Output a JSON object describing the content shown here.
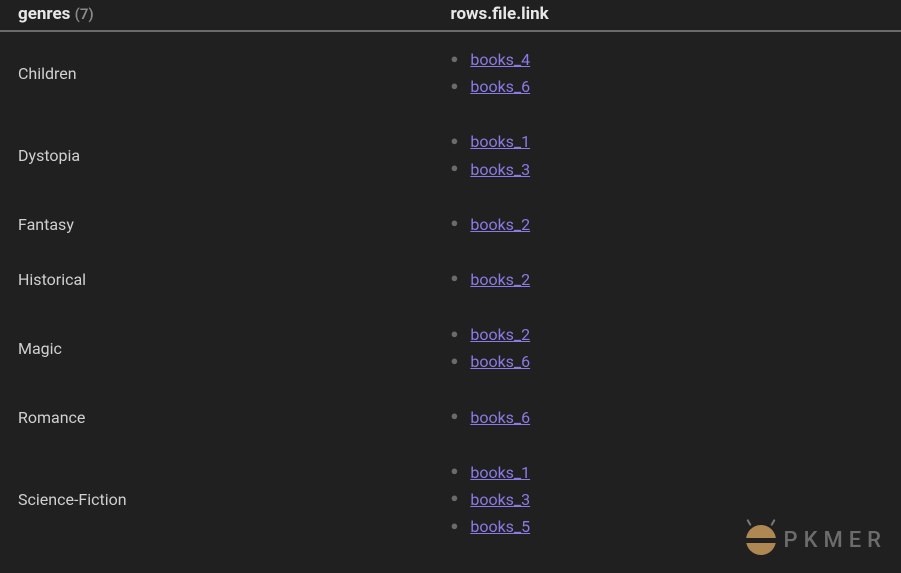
{
  "table": {
    "headers": {
      "col1": "genres",
      "count": "(7)",
      "col2": "rows.file.link"
    },
    "rows": [
      {
        "genre": "Children",
        "links": [
          "books_4",
          "books_6"
        ]
      },
      {
        "genre": "Dystopia",
        "links": [
          "books_1",
          "books_3"
        ]
      },
      {
        "genre": "Fantasy",
        "links": [
          "books_2"
        ]
      },
      {
        "genre": "Historical",
        "links": [
          "books_2"
        ]
      },
      {
        "genre": "Magic",
        "links": [
          "books_2",
          "books_6"
        ]
      },
      {
        "genre": "Romance",
        "links": [
          "books_6"
        ]
      },
      {
        "genre": "Science-Fiction",
        "links": [
          "books_1",
          "books_3",
          "books_5"
        ]
      }
    ]
  },
  "watermark": {
    "text": "PKMER"
  }
}
